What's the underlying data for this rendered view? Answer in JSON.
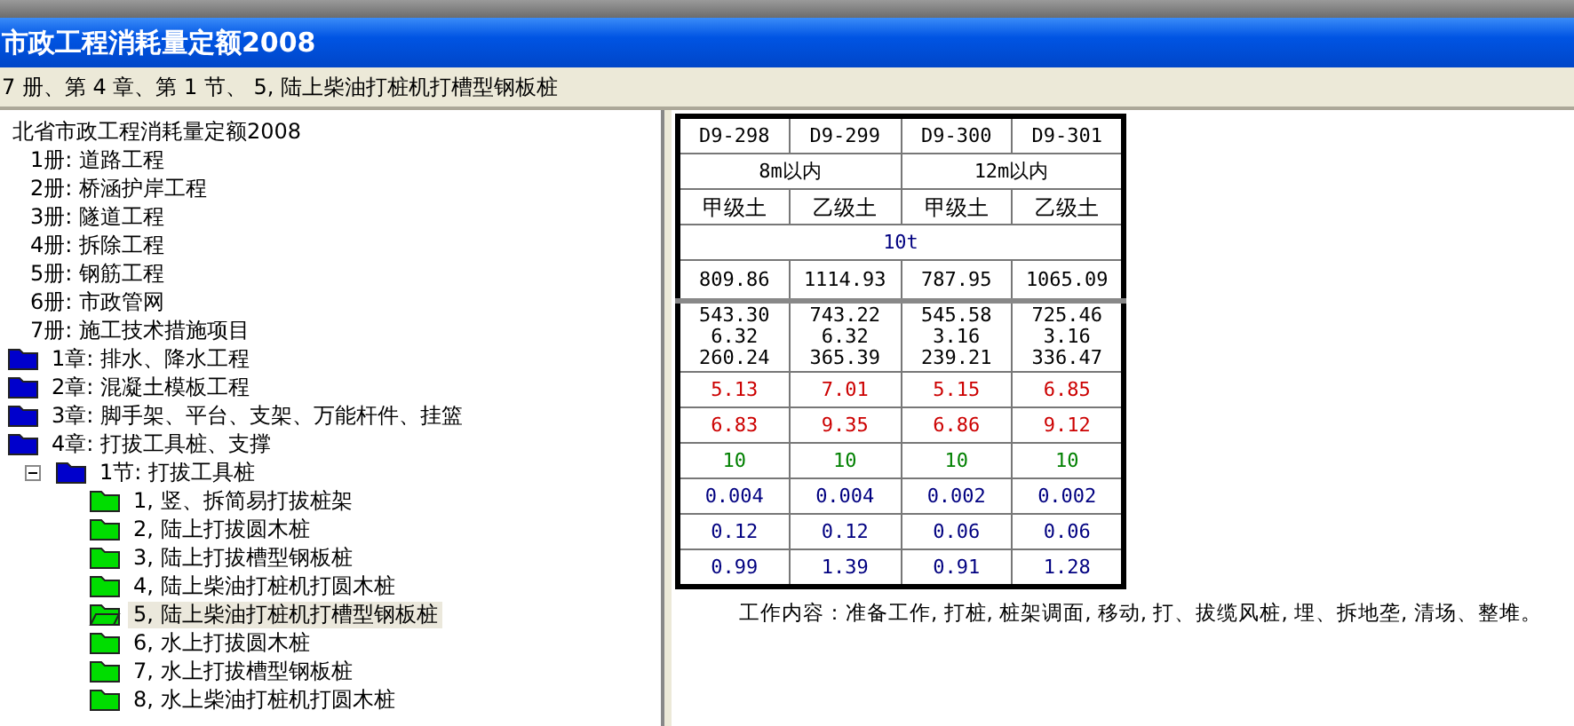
{
  "window": {
    "title": "市政工程消耗量定额2008"
  },
  "breadcrumb": "7 册、第 4 章、第 1 节、 5, 陆上柴油打桩机打槽型钢板桩",
  "tree": {
    "label": "北省市政工程消耗量定额2008",
    "children": [
      {
        "label": "1册: 道路工程"
      },
      {
        "label": "2册: 桥涵护岸工程"
      },
      {
        "label": "3册: 隧道工程"
      },
      {
        "label": "4册: 拆除工程"
      },
      {
        "label": "5册: 钢筋工程"
      },
      {
        "label": "6册: 市政管网"
      },
      {
        "label": "7册: 施工技术措施项目",
        "children": [
          {
            "label": "1章: 排水、降水工程",
            "kind": "chapter"
          },
          {
            "label": "2章: 混凝土模板工程",
            "kind": "chapter"
          },
          {
            "label": "3章: 脚手架、平台、支架、万能杆件、挂篮",
            "kind": "chapter"
          },
          {
            "label": "4章: 打拔工具桩、支撑",
            "kind": "chapter",
            "children": [
              {
                "label": "1节: 打拔工具桩",
                "kind": "section",
                "expanded": true,
                "children": [
                  {
                    "label": "1, 竖、拆简易打拔桩架",
                    "kind": "item",
                    "selected": false
                  },
                  {
                    "label": "2, 陆上打拔圆木桩",
                    "kind": "item",
                    "selected": false
                  },
                  {
                    "label": "3, 陆上打拔槽型钢板桩",
                    "kind": "item",
                    "selected": false
                  },
                  {
                    "label": "4, 陆上柴油打桩机打圆木桩",
                    "kind": "item",
                    "selected": false
                  },
                  {
                    "label": "5, 陆上柴油打桩机打槽型钢板桩",
                    "kind": "item",
                    "selected": true
                  },
                  {
                    "label": "6, 水上打拔圆木桩",
                    "kind": "item",
                    "selected": false
                  },
                  {
                    "label": "7, 水上打拔槽型钢板桩",
                    "kind": "item",
                    "selected": false
                  },
                  {
                    "label": "8, 水上柴油打桩机打圆木桩",
                    "kind": "item",
                    "selected": false
                  }
                ]
              }
            ]
          }
        ]
      }
    ]
  },
  "table": {
    "codes": [
      "D9-298",
      "D9-299",
      "D9-300",
      "D9-301"
    ],
    "groups": [
      "8m以内",
      "12m以内"
    ],
    "soil": [
      "甲级土",
      "乙级土",
      "甲级土",
      "乙级土"
    ],
    "spec": "10t",
    "base_price": [
      "809.86",
      "1114.93",
      "787.95",
      "1065.09"
    ],
    "breakdown": [
      [
        "543.30",
        "6.32",
        "260.24"
      ],
      [
        "743.22",
        "6.32",
        "365.39"
      ],
      [
        "545.58",
        "3.16",
        "239.21"
      ],
      [
        "725.46",
        "3.16",
        "336.47"
      ]
    ],
    "rows": [
      {
        "color": "#cc0000",
        "values": [
          "5.13",
          "7.01",
          "5.15",
          "6.85"
        ]
      },
      {
        "color": "#cc0000",
        "values": [
          "6.83",
          "9.35",
          "6.86",
          "9.12"
        ]
      },
      {
        "color": "#008000",
        "values": [
          "10",
          "10",
          "10",
          "10"
        ]
      },
      {
        "color": "#000080",
        "values": [
          "0.004",
          "0.004",
          "0.002",
          "0.002"
        ]
      },
      {
        "color": "#000080",
        "values": [
          "0.12",
          "0.12",
          "0.06",
          "0.06"
        ]
      },
      {
        "color": "#000080",
        "values": [
          "0.99",
          "1.39",
          "0.91",
          "1.28"
        ]
      }
    ]
  },
  "work_content": "工作内容：准备工作, 打桩, 桩架调面, 移动, 打、拔缆风桩, 埋、拆地垄, 清场、整堆。"
}
